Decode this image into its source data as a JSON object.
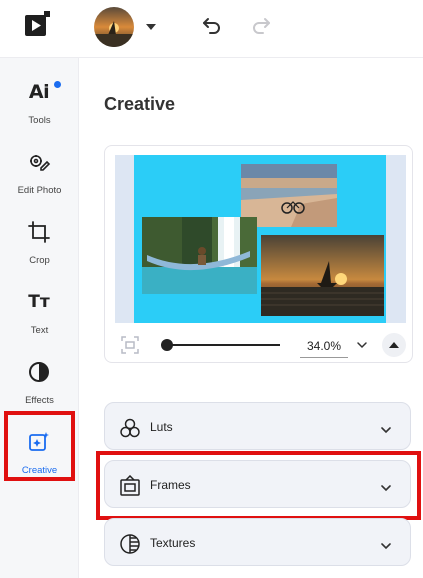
{
  "topbar": {
    "logo_icon": "play-logo-icon",
    "avatar_icon": "sunset-boat-avatar",
    "undo_icon": "undo-icon",
    "redo_icon": "redo-icon"
  },
  "sidebar": {
    "items": [
      {
        "label": "Tools",
        "glyph": "Ai",
        "icon": "ai-tools-icon"
      },
      {
        "label": "Edit Photo",
        "icon": "edit-photo-icon"
      },
      {
        "label": "Crop",
        "icon": "crop-icon"
      },
      {
        "label": "Text",
        "glyph": "Tт",
        "icon": "text-icon"
      },
      {
        "label": "Effects",
        "icon": "effects-icon"
      },
      {
        "label": "Creative",
        "icon": "creative-icon",
        "active": true
      }
    ]
  },
  "main": {
    "title": "Creative",
    "preview": {
      "zoom": "34.0%",
      "canvas_color": "#2bcdf7"
    },
    "accordions": [
      {
        "label": "Luts",
        "icon": "luts-icon"
      },
      {
        "label": "Frames",
        "icon": "frames-icon"
      },
      {
        "label": "Textures",
        "icon": "textures-icon"
      }
    ]
  },
  "colors": {
    "accent": "#1a6cf0",
    "highlight": "#e01010"
  }
}
